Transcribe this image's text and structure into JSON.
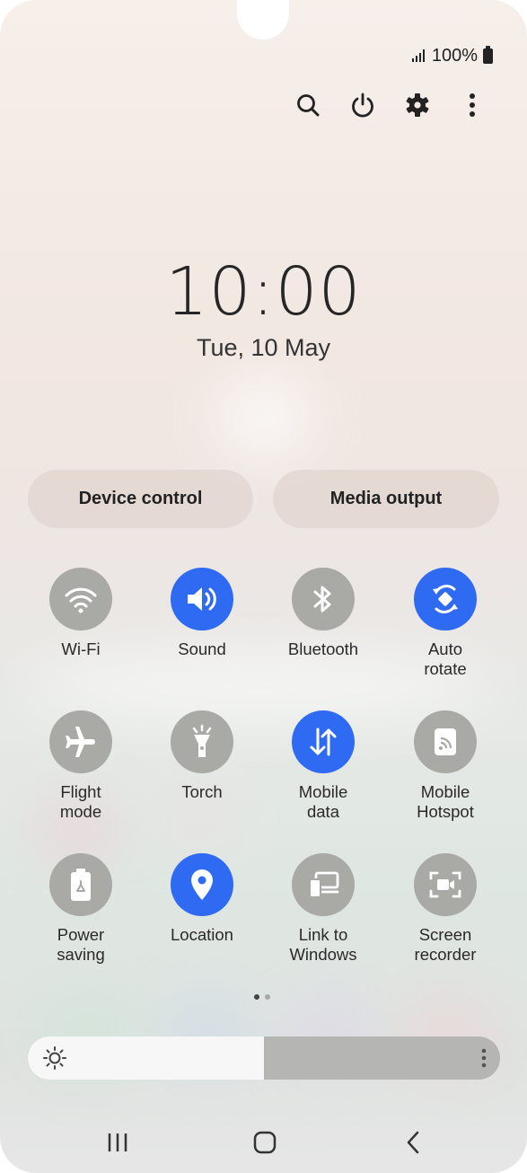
{
  "status_bar": {
    "battery": "100%"
  },
  "top_actions": [
    "search-icon",
    "power-icon",
    "settings-gear-icon",
    "more-options-icon"
  ],
  "clock": {
    "time": "10:00",
    "date": "Tue, 10 May"
  },
  "shortcuts": {
    "device_control": "Device control",
    "media_output": "Media output"
  },
  "tiles": [
    {
      "label": "Wi-Fi",
      "icon": "wifi-icon",
      "on": false
    },
    {
      "label": "Sound",
      "icon": "sound-icon",
      "on": true
    },
    {
      "label": "Bluetooth",
      "icon": "bluetooth-icon",
      "on": false
    },
    {
      "label": "Auto\nrotate",
      "icon": "auto-rotate-icon",
      "on": true
    },
    {
      "label": "Flight\nmode",
      "icon": "airplane-icon",
      "on": false
    },
    {
      "label": "Torch",
      "icon": "torch-icon",
      "on": false
    },
    {
      "label": "Mobile\ndata",
      "icon": "mobile-data-icon",
      "on": true
    },
    {
      "label": "Mobile\nHotspot",
      "icon": "hotspot-icon",
      "on": false
    },
    {
      "label": "Power\nsaving",
      "icon": "power-saving-icon",
      "on": false
    },
    {
      "label": "Location",
      "icon": "location-icon",
      "on": true
    },
    {
      "label": "Link to\nWindows",
      "icon": "link-to-windows-icon",
      "on": false
    },
    {
      "label": "Screen\nrecorder",
      "icon": "screen-recorder-icon",
      "on": false
    }
  ],
  "pager": {
    "pages": 2,
    "current": 1
  },
  "brightness": {
    "level": 0.5
  },
  "colors": {
    "accent": "#2f6bf2",
    "tile_off": "#a9a9a6"
  }
}
